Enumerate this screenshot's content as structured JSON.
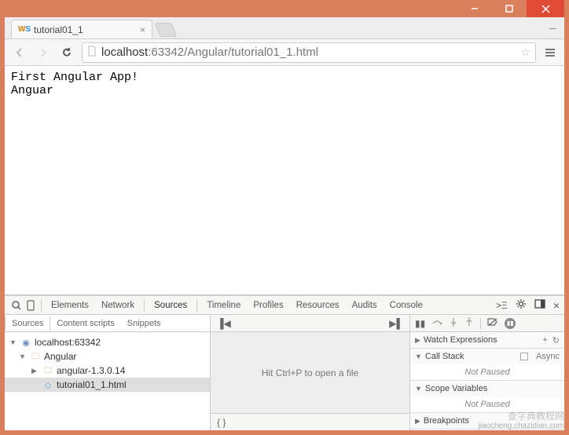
{
  "tab": {
    "title": "tutorial01_1",
    "favicon": {
      "w": "W",
      "s": "S"
    }
  },
  "url": {
    "host": "localhost",
    "port": ":63342",
    "path": "/Angular/tutorial01_1.html"
  },
  "page_body": "First Angular App!\nAnguar",
  "devtools": {
    "panels": [
      "Elements",
      "Network",
      "Sources",
      "Timeline",
      "Profiles",
      "Resources",
      "Audits",
      "Console"
    ],
    "active_panel": "Sources",
    "sources": {
      "left_tabs": [
        "Sources",
        "Content scripts",
        "Snippets"
      ],
      "active_left_tab": "Sources",
      "tree": {
        "host": "localhost:63342",
        "folder1": "Angular",
        "folder2": "angular-1.3.0.14",
        "file1": "tutorial01_1.html"
      },
      "mid_hint": "Hit Ctrl+P to open a file",
      "right": {
        "watch": {
          "label": "Watch Expressions"
        },
        "callstack": {
          "label": "Call Stack",
          "async": "Async",
          "body": "Not Paused"
        },
        "scope": {
          "label": "Scope Variables",
          "body": "Not Paused"
        },
        "breakpoints": {
          "label": "Breakpoints"
        }
      }
    }
  },
  "watermark": {
    "cn": "查字典教程网",
    "url": "jiaocheng.chazidian.com"
  }
}
